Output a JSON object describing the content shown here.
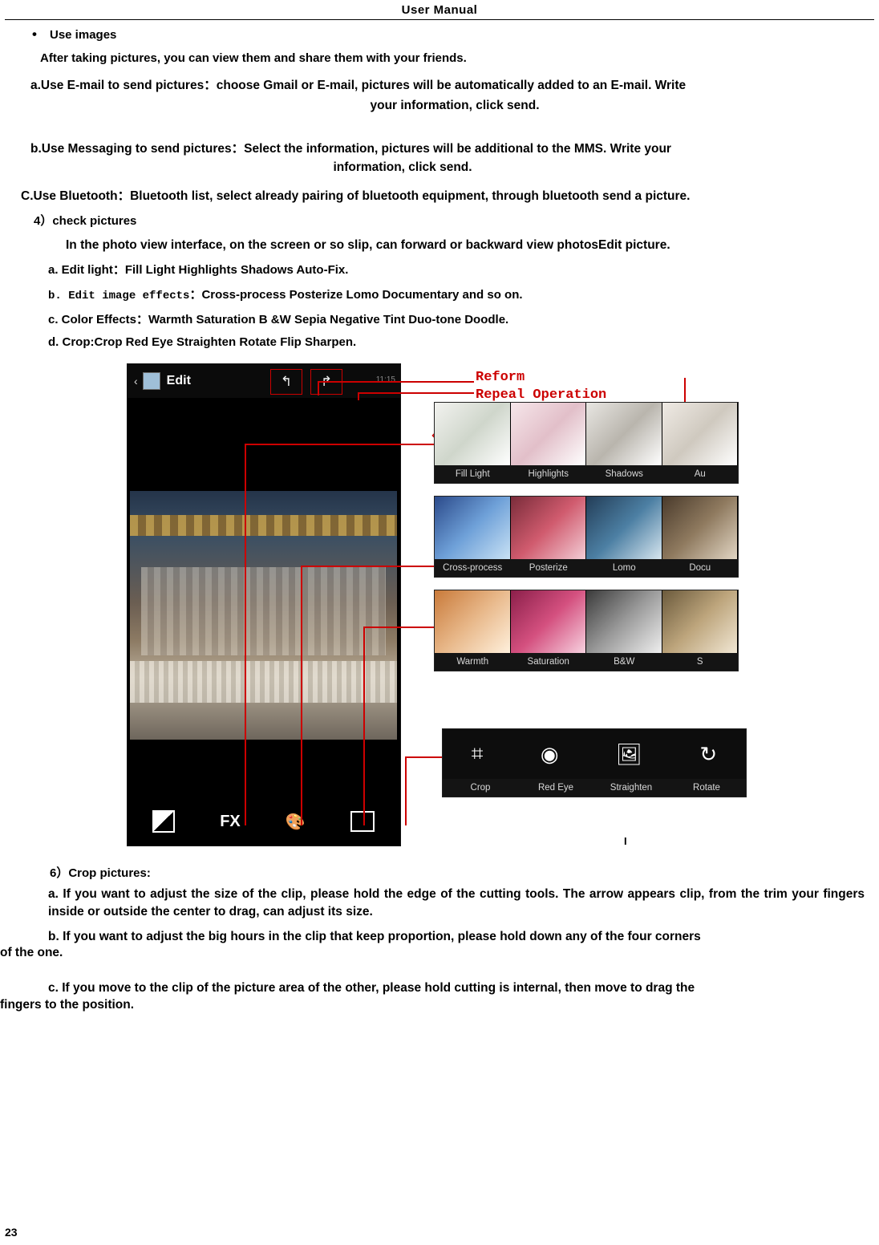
{
  "header": {
    "title": "User   Manual"
  },
  "body": {
    "bullet1": "Use images",
    "line_after": "After taking pictures, you can view them and share them with your friends.",
    "item_a_label": "a.Use E-mail to send pictures",
    "item_a_colon": "：",
    "item_a_text": "choose Gmail or E-mail, pictures will be automatically added to an E-mail.  Write",
    "item_a_text2": "your information, click send.",
    "item_b_label": "b.Use Messaging to send pictures",
    "item_b_colon": "：",
    "item_b_text": "Select the information, pictures will be additional to the MMS. Write your",
    "item_b_text2": "information, click send.",
    "item_c_label": "C.Use Bluetooth",
    "item_c_colon": "：",
    "item_c_text": "Bluetooth list, select already pairing of bluetooth equipment, through bluetooth send a picture.",
    "item_4": "4）check pictures",
    "item_4_text": "In the photo view interface, on the screen or so slip, can forward or backward view photosEdit picture.",
    "sub_a": "a. Edit light：Fill Light   Highlights   Shadows   Auto-Fix.",
    "sub_b_label": "b. Edit image effects",
    "sub_b_colon": "：",
    "sub_b_text": "Cross-process   Posterize   Lomo   Documentary and so on.",
    "sub_c": "c. Color Effects：Warmth   Saturation B &W   Sepia   Negative   Tint   Duo-tone   Doodle.",
    "sub_d": "d. Crop:Crop   Red Eye   Straighten   Rotate   Flip   Sharpen.",
    "item_6": "6）Crop pictures:",
    "item_6a": "a. If you want to adjust the size of the clip, please hold the edge of the cutting tools. The arrow appears clip, from the trim your fingers inside or outside the center to drag, can adjust its size.",
    "item_6b": "b. If you want to adjust the big hours in the clip that keep proportion, please hold down any of the four corners",
    "item_6b2": "of the one.",
    "item_6c": "c. If you move to the clip of the picture area of the other, please hold cutting is internal, then move to drag the",
    "item_6c2": "fingers to the position.",
    "page_number": "23"
  },
  "figure": {
    "phone": {
      "back_label": "‹",
      "title": "Edit",
      "undo_glyph": "↰",
      "redo_glyph": "↱",
      "clock": "11:15",
      "bottom_icons": [
        "contrast-icon",
        "FX",
        "palette-icon",
        "crop-icon"
      ],
      "fx_label": "FX"
    },
    "annotations": {
      "line1": "Reform",
      "line2": "Repeal Operation",
      "caption": "I",
      "return_marks": [
        "↵",
        "↵",
        "←"
      ]
    },
    "strips": [
      {
        "labels": [
          "Fill Light",
          "Highlights",
          "Shadows",
          "Au"
        ]
      },
      {
        "labels": [
          "Cross-process",
          "Posterize",
          "Lomo",
          "Docu"
        ]
      },
      {
        "labels": [
          "Warmth",
          "Saturation",
          "B&W",
          "S"
        ]
      },
      {
        "labels": [
          "Crop",
          "Red Eye",
          "Straighten",
          "Rotate"
        ],
        "icons": [
          "crop-icon",
          "red-eye-icon",
          "straighten-icon",
          "rotate-icon"
        ]
      }
    ]
  },
  "colors": {
    "annotation_red": "#cc0000",
    "text": "#000000",
    "page_bg": "#ffffff"
  }
}
